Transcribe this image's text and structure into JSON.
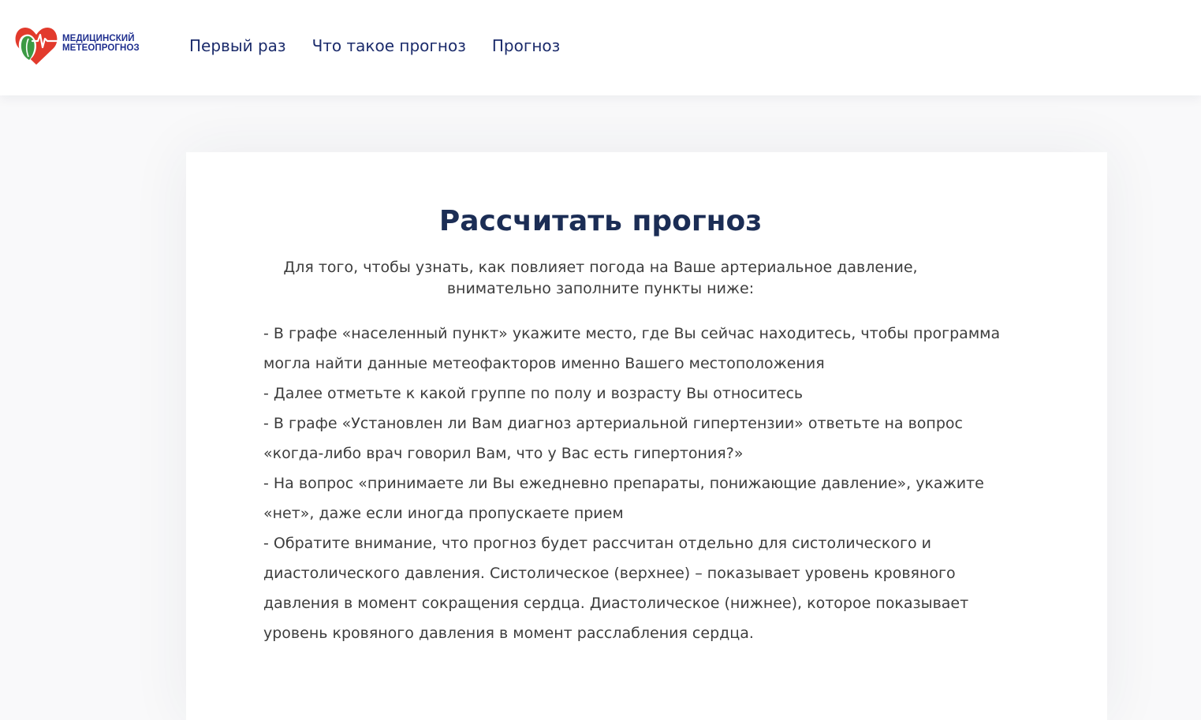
{
  "header": {
    "logo": {
      "line1": "МЕДИЦИНСКИЙ",
      "line2": "МЕТЕОПРОГНОЗ",
      "icon": "heart-leaf-pulse-icon",
      "colors": {
        "heart": "#e23a2c",
        "leaf": "#3c9a44",
        "text": "#1f2f8f"
      }
    },
    "nav": [
      {
        "label": "Первый раз"
      },
      {
        "label": "Что такое прогноз"
      },
      {
        "label": "Прогноз"
      }
    ]
  },
  "main": {
    "title": "Рассчитать прогноз",
    "subtitle_lines": [
      "Для того, чтобы узнать, как повлияет погода на Ваше артериальное давление,",
      "внимательно заполните пункты ниже:"
    ],
    "instruction_lines": [
      "- В графе «населенный пункт» укажите место, где Вы сейчас находитесь, чтобы программа",
      "могла найти данные метеофакторов именно Вашего местоположения",
      "- Далее отметьте к какой группе по полу и возрасту Вы относитесь",
      "- В графе «Установлен ли Вам диагноз артериальной гипертензии» ответьте на вопрос",
      "«когда-либо врач говорил Вам, что у Вас есть гипертония?»",
      "- На вопрос «принимаете ли Вы ежедневно препараты, понижающие давление», укажите",
      "«нет», даже если иногда пропускаете прием",
      "- Обратите внимание, что прогноз будет рассчитан отдельно для систолического и",
      "диастолического давления. Систолическое (верхнее) – показывает уровень кровяного",
      "давления в момент сокращения сердца. Диастолическое (нижнее), которое показывает",
      "уровень кровяного давления в момент расслабления сердца."
    ]
  }
}
